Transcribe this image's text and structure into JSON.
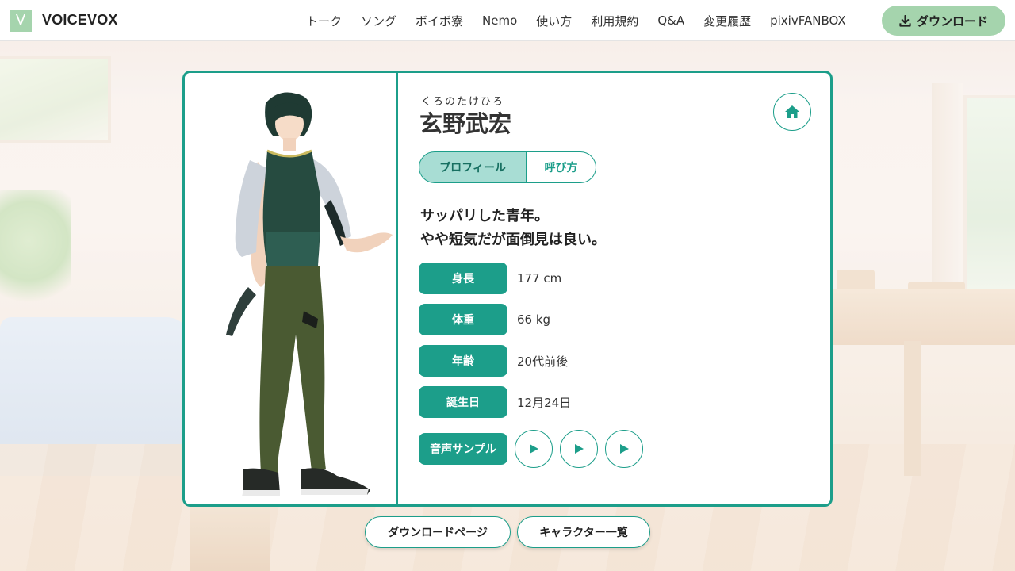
{
  "header": {
    "logo_mark": "V",
    "logo_text": "VOICEVOX",
    "nav": [
      "トーク",
      "ソング",
      "ボイボ寮",
      "Nemo",
      "使い方",
      "利用規約",
      "Q&A",
      "変更履歴",
      "pixivFANBOX"
    ],
    "download_label": "ダウンロード"
  },
  "character": {
    "ruby": "くろのたけひろ",
    "name": "玄野武宏",
    "tabs": [
      "プロフィール",
      "呼び方"
    ],
    "active_tab": "プロフィール",
    "description": [
      "サッパリした青年。",
      "やや短気だが面倒見は良い。"
    ],
    "stats": [
      {
        "label": "身長",
        "value": "177 cm"
      },
      {
        "label": "体重",
        "value": "66 kg"
      },
      {
        "label": "年齢",
        "value": "20代前後"
      },
      {
        "label": "誕生日",
        "value": "12月24日"
      }
    ],
    "sample_label": "音声サンプル"
  },
  "footer_buttons": {
    "download_page": "ダウンロードページ",
    "character_list": "キャラクター一覧"
  },
  "colors": {
    "accent": "#1c9e8a",
    "accent_light": "#a8ddd4",
    "header_button": "#a5d4ad"
  },
  "icons": {
    "download": "download-icon",
    "home": "home-icon",
    "play": "play-icon"
  }
}
